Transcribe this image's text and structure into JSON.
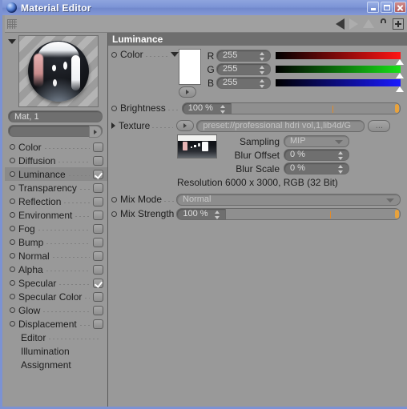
{
  "window": {
    "title": "Material Editor",
    "icon": "material-sphere-icon",
    "minimize_label": "_",
    "maximize_label": "□",
    "close_label": "×"
  },
  "toolbar": {
    "grip": "drag-grip",
    "back_icon": "back-arrow-icon",
    "forward_icon": "forward-arrow-icon",
    "up_icon": "up-arrow-icon",
    "lock_icon": "unlocked-padlock-icon",
    "add_icon": "plus-icon"
  },
  "preview": {
    "expand_icon": "collapse-triangle-icon",
    "material_name": "Mat, 1",
    "secondary_field_value": "",
    "secondary_field_button": "open-arrow-icon"
  },
  "channels": [
    {
      "label": "Color",
      "checked": false
    },
    {
      "label": "Diffusion",
      "checked": false
    },
    {
      "label": "Luminance",
      "checked": true,
      "selected": true
    },
    {
      "label": "Transparency",
      "checked": false
    },
    {
      "label": "Reflection",
      "checked": false
    },
    {
      "label": "Environment",
      "checked": false
    },
    {
      "label": "Fog",
      "checked": false
    },
    {
      "label": "Bump",
      "checked": false
    },
    {
      "label": "Normal",
      "checked": false
    },
    {
      "label": "Alpha",
      "checked": false
    },
    {
      "label": "Specular",
      "checked": true
    },
    {
      "label": "Specular Color",
      "checked": false
    },
    {
      "label": "Glow",
      "checked": false
    },
    {
      "label": "Displacement",
      "checked": false
    }
  ],
  "sections": [
    {
      "label": "Editor"
    },
    {
      "label": "Illumination"
    },
    {
      "label": "Assignment"
    }
  ],
  "panel": {
    "header": "Luminance",
    "color": {
      "label": "Color",
      "swatch_hex": "#ffffff",
      "channels": [
        {
          "name": "R",
          "value": "255",
          "gradient_to": "#ff1414"
        },
        {
          "name": "G",
          "value": "255",
          "gradient_to": "#18e018"
        },
        {
          "name": "B",
          "value": "255",
          "gradient_to": "#1a1aff"
        }
      ]
    },
    "brightness": {
      "label": "Brightness",
      "value": "100 %"
    },
    "texture": {
      "label": "Texture",
      "path": "preset://professional hdri vol,1,lib4d/G",
      "browse_label": "...",
      "sampling_label": "Sampling",
      "sampling_value": "MIP",
      "blur_offset_label": "Blur Offset",
      "blur_offset_value": "0 %",
      "blur_scale_label": "Blur Scale",
      "blur_scale_value": "0 %",
      "resolution": "Resolution 6000 x 3000, RGB (32 Bit)"
    },
    "mix_mode": {
      "label": "Mix Mode",
      "value": "Normal"
    },
    "mix_strength": {
      "label": "Mix Strength",
      "value": "100 %"
    }
  }
}
